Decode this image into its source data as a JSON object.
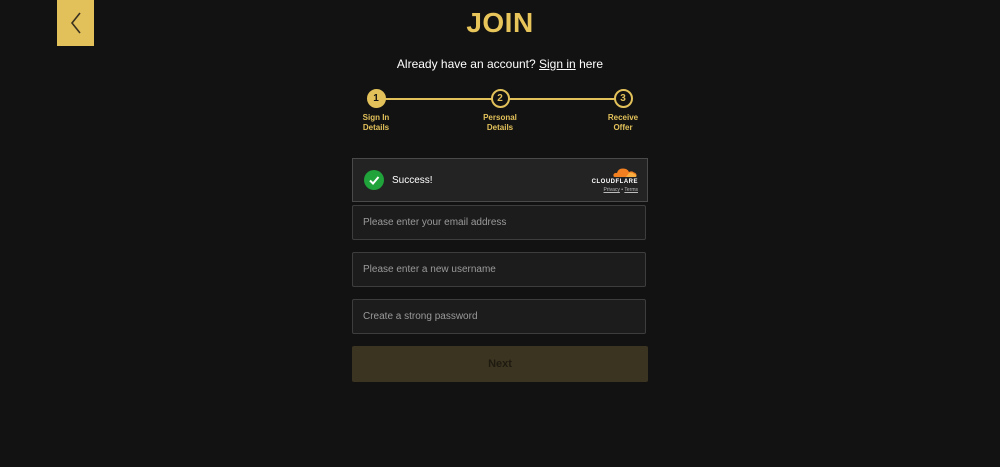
{
  "header": {
    "title": "JOIN",
    "back_icon": "chevron-left-icon"
  },
  "signin": {
    "prefix": "Already have an account?",
    "link_label": "Sign in",
    "suffix": "here"
  },
  "stepper": {
    "steps": [
      {
        "number": "1",
        "label_line1": "Sign In",
        "label_line2": "Details",
        "active": true
      },
      {
        "number": "2",
        "label_line1": "Personal",
        "label_line2": "Details",
        "active": false
      },
      {
        "number": "3",
        "label_line1": "Receive",
        "label_line2": "Offer",
        "active": false
      }
    ]
  },
  "captcha": {
    "status": "Success!",
    "brand": "CLOUDFLARE",
    "privacy_label": "Privacy",
    "separator": "•",
    "terms_label": "Terms"
  },
  "form": {
    "email_placeholder": "Please enter your email address",
    "email_value": "",
    "username_placeholder": "Please enter a new username",
    "username_value": "",
    "password_placeholder": "Create a strong password",
    "password_value": "",
    "next_label": "Next"
  },
  "colors": {
    "background": "#121212",
    "accent": "#e2c15a",
    "success": "#1fa33a",
    "cloudflare_orange": "#f38020"
  }
}
